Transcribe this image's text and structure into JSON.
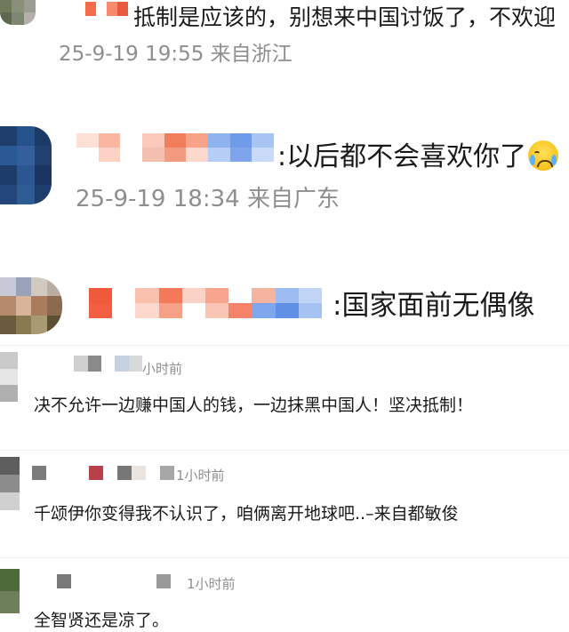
{
  "comments": [
    {
      "id": "top-1",
      "text": "抵制是应该的，别想来中国讨饭了，不欢迎",
      "time": "25-9-19 19:55",
      "location": "来自浙江"
    },
    {
      "id": "top-2",
      "text": ":以后都不会喜欢你了",
      "emoji": "crying-face",
      "time": "25-9-19 18:34",
      "location": "来自广东"
    },
    {
      "id": "top-3",
      "text": ":国家面前无偶像"
    }
  ],
  "replies": [
    {
      "time": "小时前",
      "text": "决不允许一边赚中国人的钱，一边抹黑中国人！坚决抵制！"
    },
    {
      "time": "1小时前",
      "text": "千颂伊你变得我不认识了，咱俩离开地球吧..–来自都敏俊"
    },
    {
      "time": "1小时前",
      "text": "全智贤还是凉了。"
    }
  ]
}
